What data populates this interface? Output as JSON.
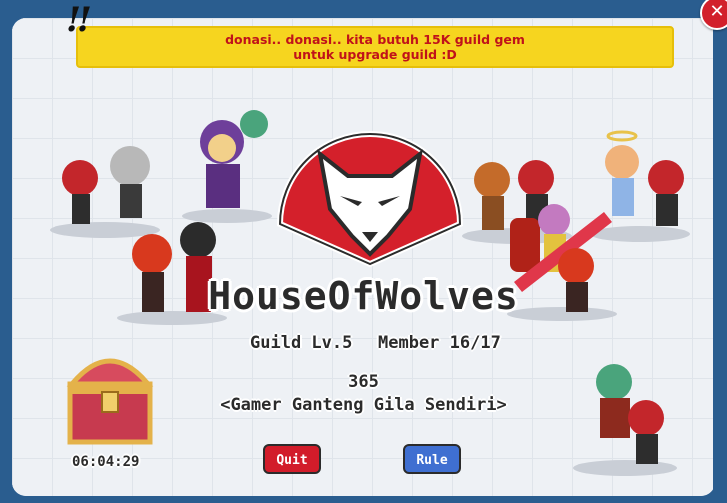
{
  "banner": {
    "line1": "donasi.. donasi.. kita butuh 15K guild gem",
    "line2": "untuk upgrade guild :D",
    "decoration": "!!"
  },
  "guild": {
    "name": "HouseOfWolves",
    "level_text": "Guild Lv.5",
    "member_text": "Member 16/17",
    "points": "365",
    "motto": "<Gamer Ganteng Gila Sendiri>"
  },
  "chest": {
    "timer": "06:04:29"
  },
  "buttons": {
    "quit": "Quit",
    "rule": "Rule"
  },
  "colors": {
    "banner_bg": "#f6d51f",
    "banner_text": "#c0121a",
    "quit_bg": "#d21c2a",
    "rule_bg": "#3f6fd1",
    "emblem_red": "#d4202b"
  },
  "icons": {
    "close": "close-x-icon",
    "emblem": "wolf-emblem-icon",
    "chest": "treasure-chest-icon"
  },
  "close_glyph": "✕"
}
